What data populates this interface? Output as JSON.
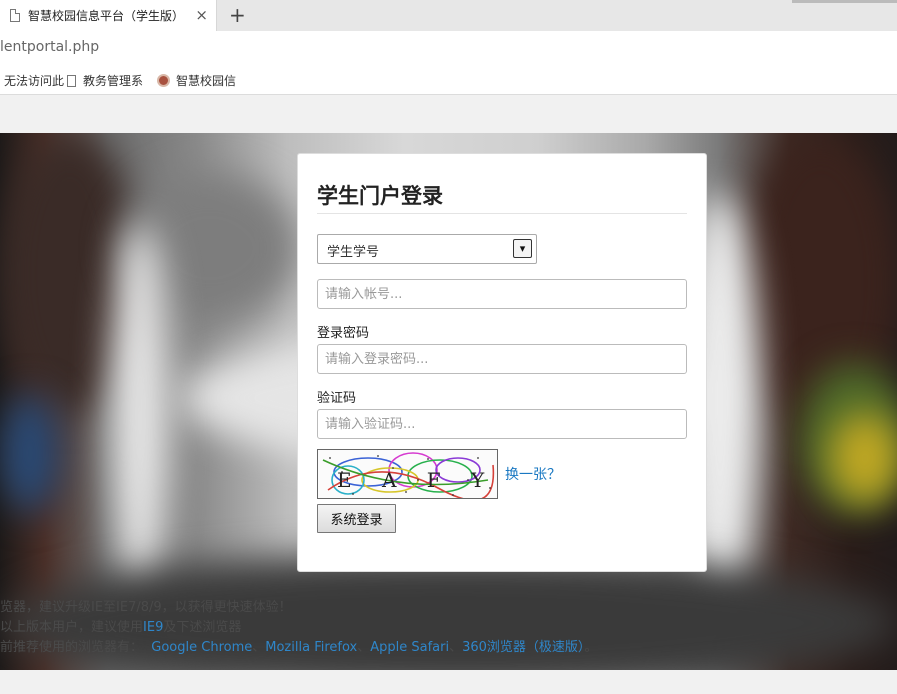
{
  "browser": {
    "tab_title": "智慧校园信息平台（学生版）",
    "tab_close": "×",
    "new_tab": "+",
    "url": "lentportal.php",
    "bookmarks": [
      {
        "label": "无法访问此"
      },
      {
        "label": "教务管理系"
      },
      {
        "label": "智慧校园信"
      }
    ]
  },
  "login": {
    "title": "学生门户登录",
    "account_type": {
      "selected": "学生学号",
      "arrow": "▾"
    },
    "account": {
      "placeholder": "请输入帐号..."
    },
    "password": {
      "label": "登录密码",
      "placeholder": "请输入登录密码..."
    },
    "captcha": {
      "label": "验证码",
      "placeholder": "请输入验证码...",
      "refresh": "换一张？",
      "text": "E A F Y"
    },
    "submit": "系统登录"
  },
  "notes": {
    "line1": "览器，建议升级IE至IE7/8/9，以获得更快速体验！",
    "line2_pre": "以上版本用户，建议使用",
    "line2_link": "IE9",
    "line2_post": "及下述浏览器",
    "line3_pre": "前推荐使用的浏览器有：",
    "browsers": [
      "Google Chrome",
      "Mozilla Firefox",
      "Apple Safari",
      "360浏览器（极速版）"
    ],
    "sep": "、",
    "end": "。"
  },
  "colors": {
    "link": "#1a78c2",
    "panel_bg": "#ffffff"
  }
}
